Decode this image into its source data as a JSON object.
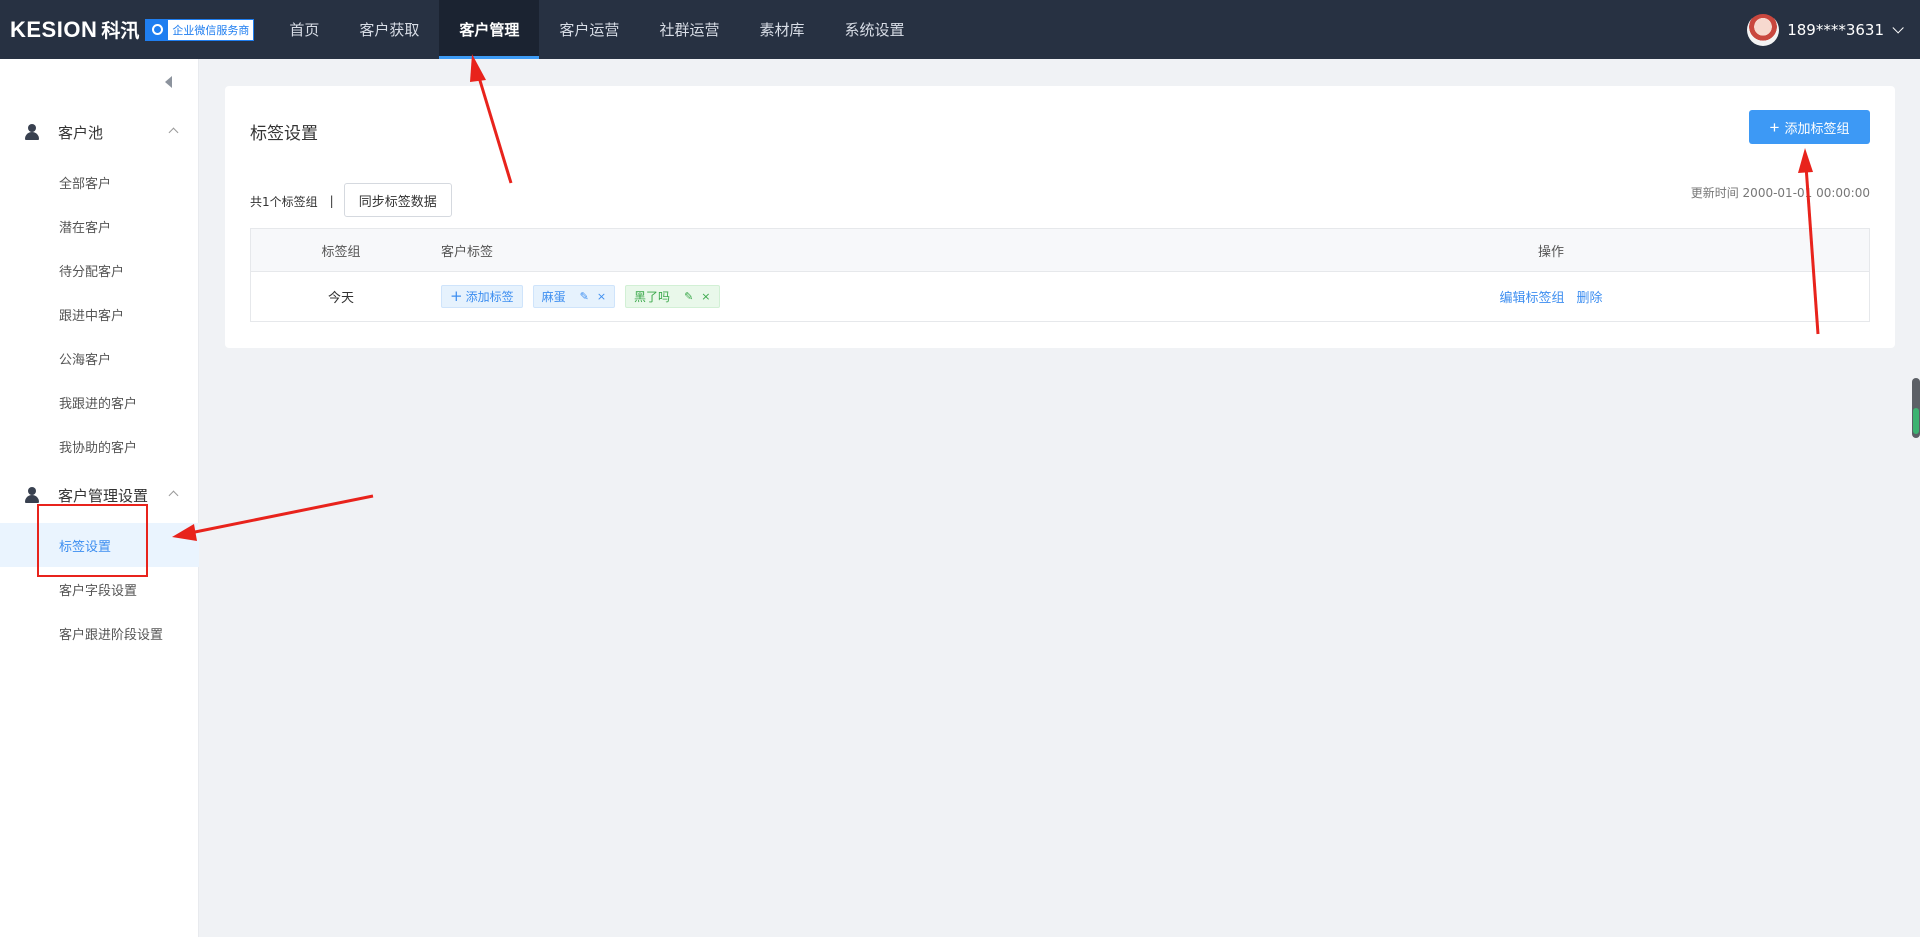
{
  "brand": {
    "logo_text": "KESION",
    "logo_cn": "科汛",
    "badge": "企业微信服务商"
  },
  "nav": {
    "items": [
      {
        "label": "首页"
      },
      {
        "label": "客户获取"
      },
      {
        "label": "客户管理"
      },
      {
        "label": "客户运营"
      },
      {
        "label": "社群运营"
      },
      {
        "label": "素材库"
      },
      {
        "label": "系统设置"
      }
    ],
    "active_index": 2
  },
  "user": {
    "name": "189****3631"
  },
  "sidebar": {
    "groups": [
      {
        "label": "客户池",
        "icon": "users-icon",
        "items": [
          {
            "label": "全部客户"
          },
          {
            "label": "潜在客户"
          },
          {
            "label": "待分配客户"
          },
          {
            "label": "跟进中客户"
          },
          {
            "label": "公海客户"
          },
          {
            "label": "我跟进的客户"
          },
          {
            "label": "我协助的客户"
          }
        ]
      },
      {
        "label": "客户管理设置",
        "icon": "user-settings-icon",
        "items": [
          {
            "label": "标签设置",
            "active": true
          },
          {
            "label": "客户字段设置"
          },
          {
            "label": "客户跟进阶段设置"
          }
        ]
      }
    ]
  },
  "page": {
    "title": "标签设置",
    "add_group_label": "添加标签组",
    "summary": "共1个标签组",
    "separator": "|",
    "sync_label": "同步标签数据",
    "updated": "更新时间 2000-01-01 00:00:00"
  },
  "table": {
    "headers": [
      "标签组",
      "客户标签",
      "操作"
    ],
    "rows": [
      {
        "group": "今天",
        "add_tag_label": "添加标签",
        "tags": [
          {
            "name": "麻蛋",
            "color": "blue"
          },
          {
            "name": "黑了吗",
            "color": "green"
          }
        ],
        "actions": [
          "编辑标签组",
          "删除"
        ]
      }
    ]
  },
  "colors": {
    "topbar": "#273142",
    "accent": "#3d99f5",
    "annotation": "#e8231c"
  }
}
